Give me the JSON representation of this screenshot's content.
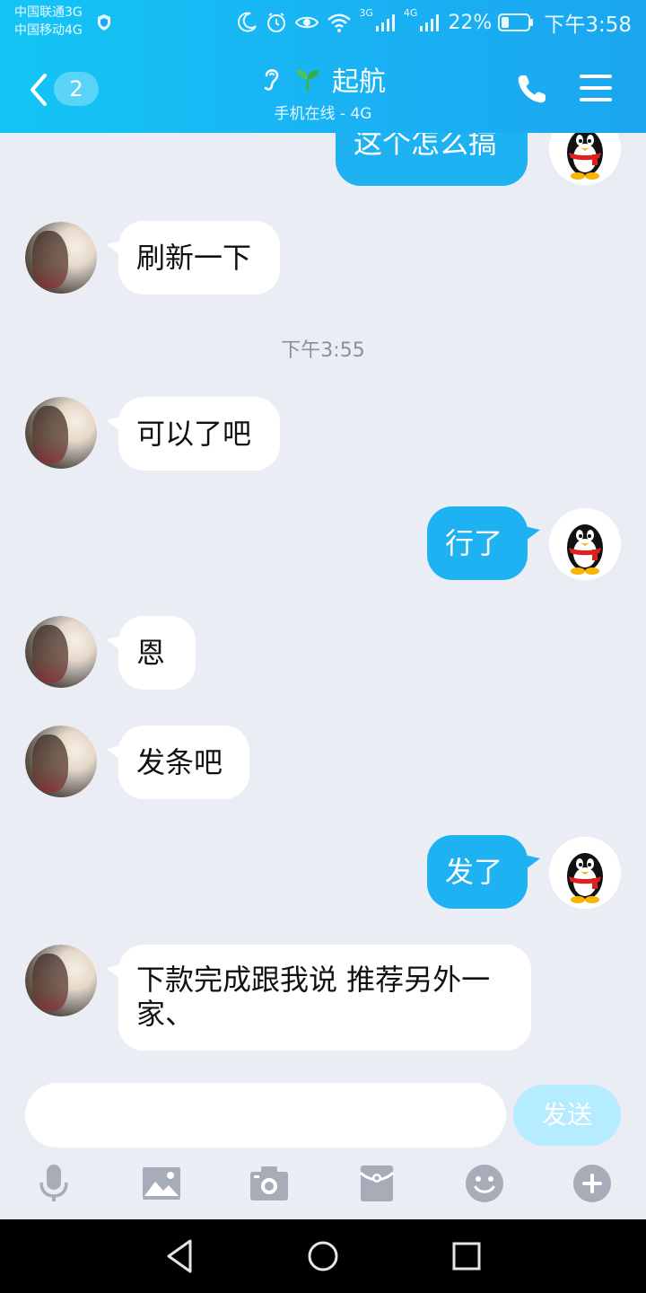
{
  "status_bar": {
    "carrier1": "中国联通3G",
    "carrier2": "中国移动4G",
    "net1": "3G",
    "net2": "4G",
    "battery_percent": "22%",
    "time": "下午3:58",
    "icons": [
      "shield-icon",
      "moon-icon",
      "alarm-icon",
      "eye-icon",
      "wifi-icon",
      "signal-icon",
      "battery-icon"
    ]
  },
  "header": {
    "back_badge": "2",
    "title": "起航",
    "subtitle": "手机在线 - 4G",
    "icons": [
      "back-icon",
      "ear-icon",
      "sprout-icon",
      "phone-icon",
      "menu-icon"
    ]
  },
  "chat": {
    "messages": [
      {
        "side": "right",
        "text": "这个怎么搞"
      },
      {
        "side": "left",
        "text": "刷新一下"
      },
      {
        "side": "left",
        "text": "可以了吧"
      },
      {
        "side": "right",
        "text": "行了"
      },
      {
        "side": "left",
        "text": "恩"
      },
      {
        "side": "left",
        "text": "发条吧"
      },
      {
        "side": "right",
        "text": "发了"
      },
      {
        "side": "left",
        "text": "下款完成跟我说 推荐另外一家、"
      }
    ],
    "timestamp": "下午3:55"
  },
  "composer": {
    "placeholder": "",
    "send_label": "发送"
  },
  "toolbar": {
    "icons": [
      "microphone-icon",
      "image-icon",
      "camera-icon",
      "red-packet-icon",
      "emoji-icon",
      "plus-icon"
    ]
  },
  "colors": {
    "accent": "#1fb2f2",
    "header_blue": "#19b2f3",
    "chat_bg": "#eaedf4",
    "send_disabled": "#b6ecff",
    "icon_gray": "#a6adb9"
  }
}
